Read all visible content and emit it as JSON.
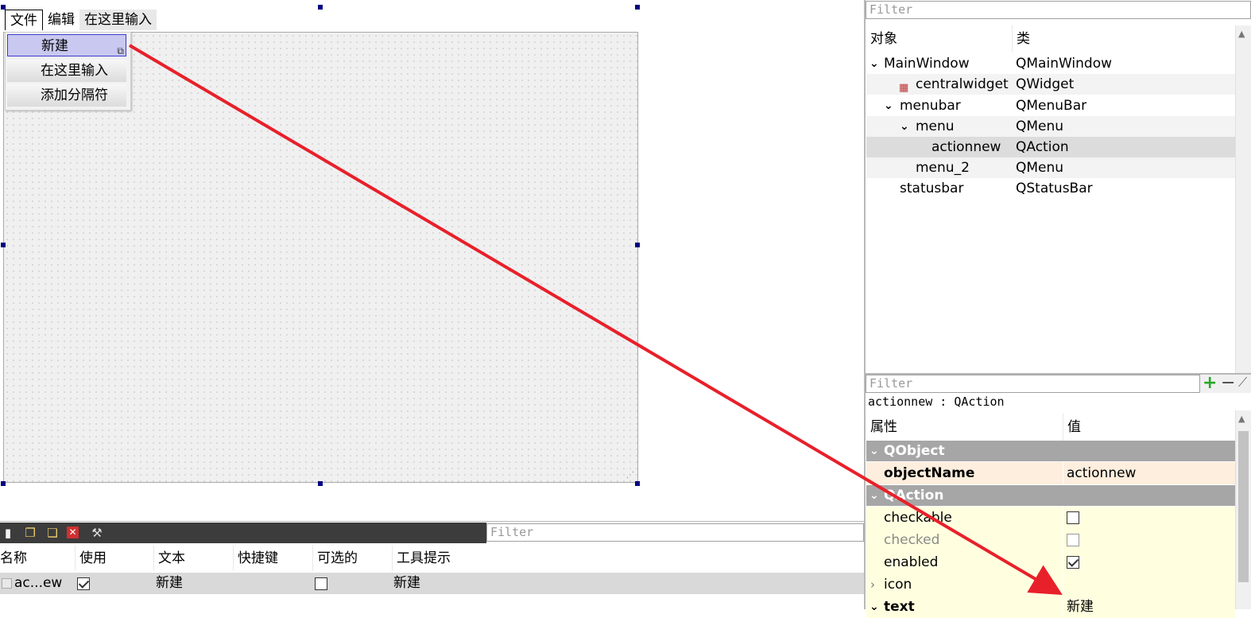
{
  "form": {
    "menubar": {
      "items": [
        "文件",
        "编辑",
        "在这里输入"
      ]
    },
    "dropdown": {
      "items": [
        "新建",
        "在这里输入",
        "添加分隔符"
      ]
    }
  },
  "object_inspector": {
    "filter_placeholder": "Filter",
    "columns": [
      "对象",
      "类"
    ],
    "rows": [
      {
        "name": "MainWindow",
        "cls": "QMainWindow"
      },
      {
        "name": "centralwidget",
        "cls": "QWidget"
      },
      {
        "name": "menubar",
        "cls": "QMenuBar"
      },
      {
        "name": "menu",
        "cls": "QMenu"
      },
      {
        "name": "actionnew",
        "cls": "QAction"
      },
      {
        "name": "menu_2",
        "cls": "QMenu"
      },
      {
        "name": "statusbar",
        "cls": "QStatusBar"
      }
    ]
  },
  "property_editor": {
    "filter_placeholder": "Filter",
    "add_label": "+",
    "remove_label": "−",
    "title": "actionnew : QAction",
    "columns": [
      "属性",
      "值"
    ],
    "groups": [
      "QObject",
      "QAction"
    ],
    "rows": [
      {
        "name": "objectName",
        "value": "actionnew"
      },
      {
        "name": "checkable",
        "checked": false
      },
      {
        "name": "checked",
        "checked": false
      },
      {
        "name": "enabled",
        "checked": true
      },
      {
        "name": "icon",
        "value": ""
      },
      {
        "name": "text",
        "value": "新建"
      }
    ]
  },
  "action_editor": {
    "filter_placeholder": "Filter",
    "columns": [
      "名称",
      "使用",
      "文本",
      "快捷键",
      "可选的",
      "工具提示"
    ],
    "row": {
      "name": "ac...ew",
      "used": true,
      "text": "新建",
      "shortcut": "",
      "checkable": false,
      "tooltip": "新建"
    }
  },
  "colors": {
    "arrow": "#e8202a",
    "selection": "#c8c8f0",
    "group": "#a6a6a6",
    "objectname_row": "#fdeedd",
    "qaction_row": "#ffffe0"
  }
}
